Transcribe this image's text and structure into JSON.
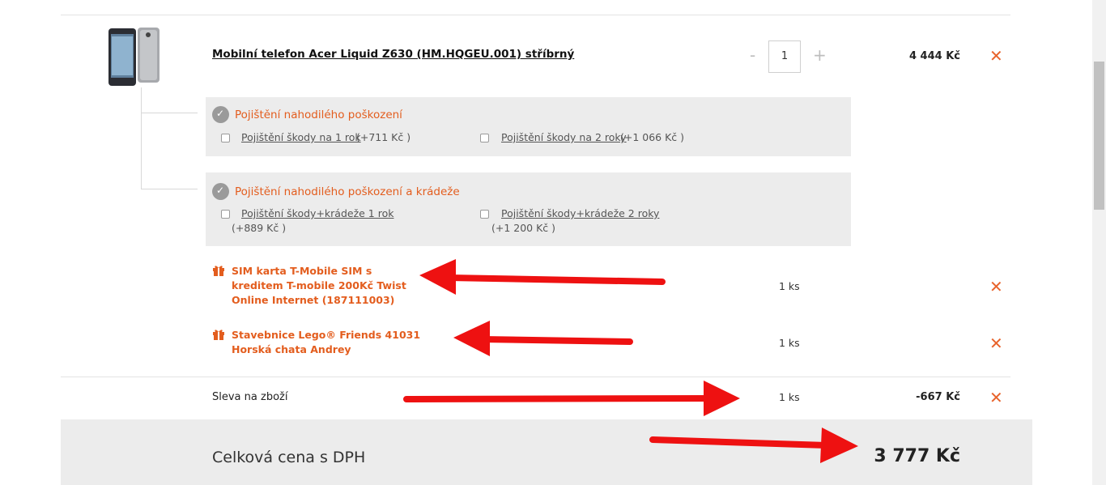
{
  "product": {
    "name": "Mobilní telefon Acer Liquid Z630 (HM.HQGEU.001) stříbrný",
    "quantity": "1",
    "qty_minus": "-",
    "qty_plus": "+",
    "price": "4 444 Kč",
    "remove": "✕"
  },
  "insurance": [
    {
      "title": "Pojištění nahodilého poškození",
      "options": [
        {
          "label": "Pojištění škody na 1 rok",
          "price": "(+711 Kč )"
        },
        {
          "label": "Pojištění škody na 2 roky",
          "price": "(+1 066 Kč )"
        }
      ]
    },
    {
      "title": "Pojištění nahodilého poškození a krádeže",
      "options": [
        {
          "label": "Pojištění škody+krádeže 1 rok",
          "price": "(+889 Kč )"
        },
        {
          "label": "Pojištění škody+krádeže 2 roky",
          "price": "(+1 200 Kč )"
        }
      ]
    }
  ],
  "gifts": [
    {
      "name": "SIM karta T-Mobile SIM s kreditem T-mobile 200Kč Twist Online Internet (187111003)",
      "qty": "1 ks",
      "remove": "✕"
    },
    {
      "name": "Stavebnice Lego® Friends 41031 Horská chata Andrey",
      "qty": "1 ks",
      "remove": "✕"
    }
  ],
  "discount": {
    "label": "Sleva na zboží",
    "qty": "1 ks",
    "price": "-667 Kč",
    "remove": "✕"
  },
  "total": {
    "label": "Celková cena s DPH",
    "value": "3 777 Kč"
  },
  "colors": {
    "accent": "#e35d1e",
    "remove": "#e8632c",
    "panel": "#ececec",
    "annotation": "#ee1111"
  }
}
